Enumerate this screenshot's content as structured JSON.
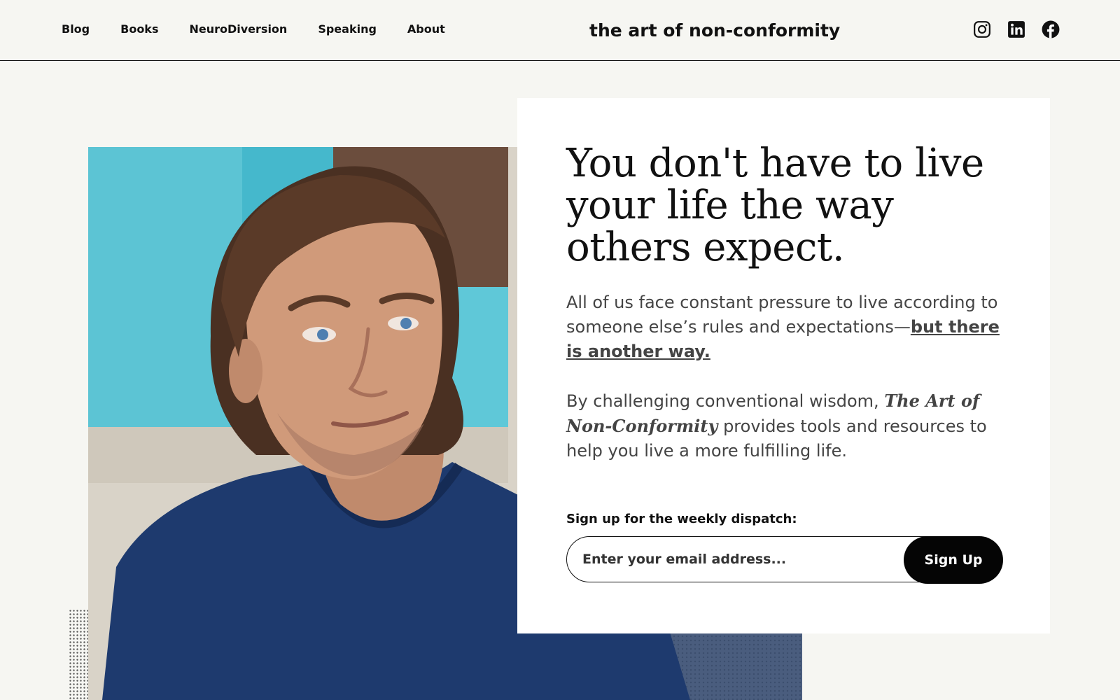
{
  "header": {
    "nav": [
      "Blog",
      "Books",
      "NeuroDiversion",
      "Speaking",
      "About"
    ],
    "site_title": "the art of non-conformity",
    "socials": [
      "instagram-icon",
      "linkedin-icon",
      "facebook-icon"
    ]
  },
  "hero": {
    "headline": "You don't have to live your life the way others expect.",
    "para1_text": "All of us face constant pressure to live according to someone else’s rules and expectations—",
    "para1_link": "but there is another way.",
    "para2_before": "By challenging conventional wisdom, ",
    "para2_book": "The Art of Non-Conformity",
    "para2_after": " provides tools and resources to help you live a more fulfilling life.",
    "signup_label": "Sign up for the weekly dispatch:",
    "email_placeholder": "Enter your email address...",
    "signup_button": "Sign Up"
  },
  "colors": {
    "background": "#f6f6f2",
    "card": "#ffffff",
    "text": "#111111",
    "body_text": "#444444",
    "button": "#050505"
  }
}
